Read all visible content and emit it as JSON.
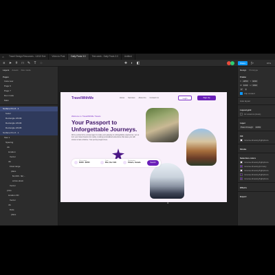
{
  "tabs": [
    {
      "label": "Travel Design Resources - UI/UX Eve"
    },
    {
      "label": "Video to Post"
    },
    {
      "label": "Daily Posts 3.0"
    },
    {
      "label": "Test week - Daily Posts 3.0"
    },
    {
      "label": "Untitled"
    }
  ],
  "toolbar": {
    "share_label": "Share",
    "zoom_label": "97%"
  },
  "left_panel": {
    "tabs": [
      "Layers",
      "Assets",
      "Dev mode"
    ],
    "pages_label": "Pages",
    "pages": [
      "Insta new",
      "Page 6",
      "Page 7",
      "Dev mode",
      "Main"
    ],
    "layers": [
      {
        "label": "Surface Pro 8 - 1",
        "state": "sel"
      },
      {
        "label": "footer",
        "state": "sel2"
      },
      {
        "label": "Rectangle 23449",
        "state": "sel2"
      },
      {
        "label": "Rectangle 23446",
        "state": "sel2"
      },
      {
        "label": "Rectangle 23445",
        "state": "sel2"
      },
      {
        "label": "Surface Pro 8 - 1",
        "state": "sel2"
      },
      {
        "label": "Star 1",
        "state": ""
      },
      {
        "label": "Spacing",
        "state": ""
      },
      {
        "label": "div",
        "state": ""
      },
      {
        "label": "location",
        "state": ""
      },
      {
        "label": "Vector",
        "state": ""
      },
      {
        "label": "div",
        "state": ""
      },
      {
        "label": "Final range",
        "state": ""
      },
      {
        "label": "place",
        "state": ""
      },
      {
        "label": "$1,000 - $2,...",
        "state": ""
      },
      {
        "label": "arrow-down",
        "state": ""
      },
      {
        "label": "Vector",
        "state": ""
      },
      {
        "label": "price",
        "state": ""
      },
      {
        "label": "location 3D",
        "state": ""
      },
      {
        "label": "Vector",
        "state": ""
      },
      {
        "label": "div",
        "state": ""
      },
      {
        "label": "Date",
        "state": ""
      },
      {
        "label": "place",
        "state": ""
      }
    ]
  },
  "right_panel": {
    "tabs": [
      "Design",
      "Prototype"
    ],
    "frame_label": "Frame",
    "x_label": "X",
    "x_value": "-4653",
    "y_label": "Y",
    "y_value": "3233",
    "w_label": "W",
    "w_value": "1440",
    "h_label": "H",
    "h_value": "1024",
    "rotation_value": "0°",
    "radius_value": "0",
    "clip_label": "Clip content",
    "autolayout_label": "Auto layout",
    "layout_grid_label": "Layout grid",
    "grid_value": "12 columns (Auto)",
    "layer_label": "Layer",
    "pass_through": "Pass through",
    "opacity_value": "100%",
    "fill_label": "Fill",
    "fill_value": "rxname-itinerary/lightphoto",
    "fill_opacity": "100%",
    "stroke_label": "Stroke",
    "selection_colors_label": "Selection colors",
    "selection_colors": [
      {
        "label": "rxname-itinerary/lightphoto",
        "color": "#f9f0fb"
      },
      {
        "label": "rxname-itinerary/primary",
        "color": "#6a1fb8"
      },
      {
        "label": "rxname-itinerary/lightphoto",
        "color": "#efe1fa"
      },
      {
        "label": "rxname-itinerary/lightphoto",
        "color": "#3d1266"
      },
      {
        "label": "rxname-itinerary/lightphoto",
        "color": "#5b1e9e"
      }
    ],
    "effects_label": "Effects",
    "export_label": "Export"
  },
  "site": {
    "logo": "TravelWithMe",
    "nav": [
      "Home",
      "Services",
      "About Us",
      "Contact Us"
    ],
    "login_label": "Login",
    "signup_label": "Sign Up",
    "welcome": "Welcome to TravelWithMe Travels",
    "title": "Your Passport to Unforgettable Journeys.",
    "description": "We're excited to be a travel agent to make your gateway to unforgettable experiences. Let us turn your travel dreams into reality, curating personalized adventures that leave you with stories to last a lifetime. Your journey begins here.",
    "search": {
      "price_label": "Price range",
      "price_value": "$1000 - $2000",
      "date_label": "Date",
      "date_value": "Mon, Dec 19th",
      "dest_label": "Destination",
      "dest_value": "Ontario, Canada",
      "button": "Search"
    }
  },
  "colors": {
    "accent": "#6a1fb8",
    "brand_dark": "#3d1266",
    "site_bg": "#f9f0fb"
  }
}
